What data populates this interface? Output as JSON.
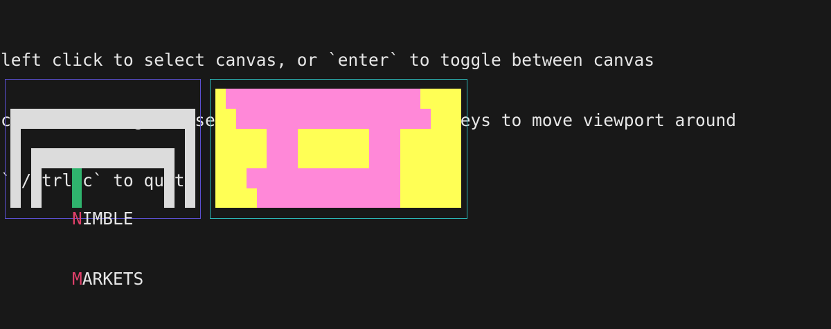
{
  "help_lines": [
    "left click to select canvas, or `enter` to toggle between canvas",
    "click and drag, mouse wheel scroll or arrow keys to move viewport around",
    "`q/ctrl+c` to quit"
  ],
  "canvas_left": {
    "logo_line1_initial": "N",
    "logo_line1_rest": "IMBLE",
    "logo_line2_initial": "M",
    "logo_line2_rest": "ARKETS"
  },
  "colors": {
    "canvas_left_border": "#5a4fcf",
    "canvas_right_border": "#2bb5b5",
    "logo_gray": "#dcdcdc",
    "pink": "#ff88d8",
    "yellow": "#ffff55",
    "green": "#2fb36d",
    "background": "#181818"
  }
}
